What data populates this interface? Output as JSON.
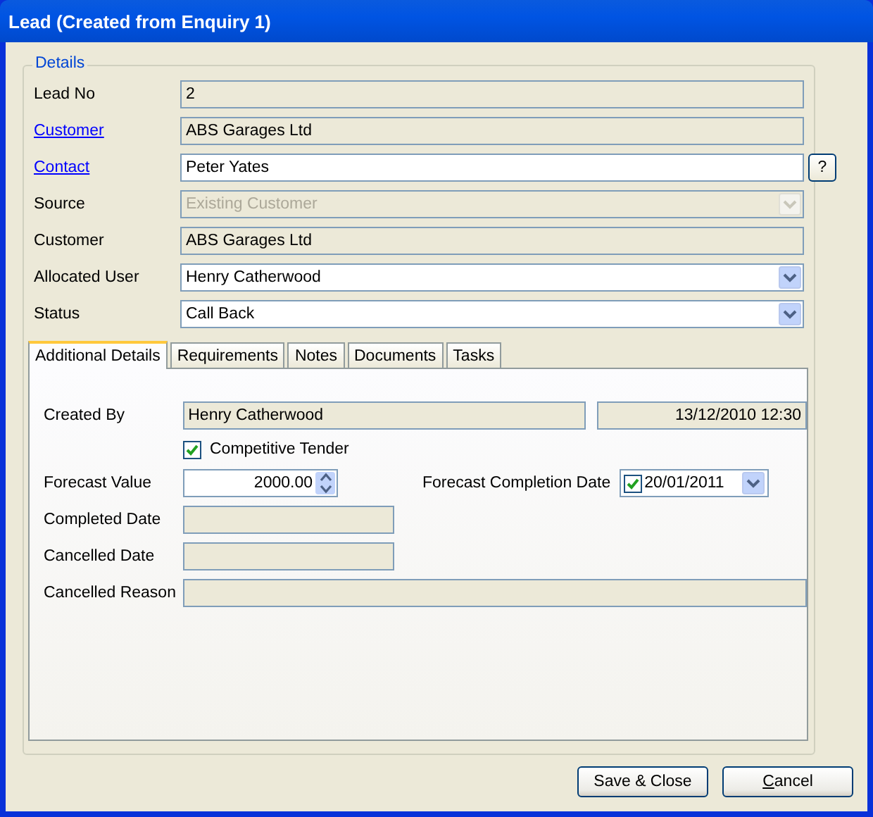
{
  "window": {
    "title": "Lead (Created from Enquiry 1)"
  },
  "details": {
    "legend": "Details",
    "fields": [
      {
        "label": "Lead No",
        "link": false,
        "kind": "readonly",
        "value": "2"
      },
      {
        "label": "Customer",
        "link": true,
        "kind": "readonly",
        "value": "ABS Garages Ltd"
      },
      {
        "label": "Contact",
        "link": true,
        "kind": "text",
        "value": "Peter Yates",
        "help": "?"
      },
      {
        "label": "Source",
        "link": false,
        "kind": "select",
        "value": "Existing Customer",
        "disabled": true
      },
      {
        "label": "Customer",
        "link": false,
        "kind": "readonly",
        "value": "ABS Garages Ltd"
      },
      {
        "label": "Allocated User",
        "link": false,
        "kind": "select",
        "value": "Henry Catherwood",
        "disabled": false
      },
      {
        "label": "Status",
        "link": false,
        "kind": "select",
        "value": "Call Back",
        "disabled": false
      }
    ]
  },
  "tabs": [
    {
      "label": "Additional Details",
      "selected": true
    },
    {
      "label": "Requirements",
      "selected": false
    },
    {
      "label": "Notes",
      "selected": false
    },
    {
      "label": "Documents",
      "selected": false
    },
    {
      "label": "Tasks",
      "selected": false
    }
  ],
  "additional": {
    "created_by": {
      "label": "Created By",
      "value": "Henry Catherwood",
      "timestamp": "13/12/2010 12:30"
    },
    "competitive_tender": {
      "label": "Competitive Tender",
      "checked": true
    },
    "forecast_value": {
      "label": "Forecast Value",
      "value": "2000.00"
    },
    "forecast_completion_date": {
      "label": "Forecast Completion Date",
      "checked": true,
      "value": "20/01/2011"
    },
    "completed_date": {
      "label": "Completed Date"
    },
    "cancelled_date": {
      "label": "Cancelled Date"
    },
    "cancelled_reason": {
      "label": "Cancelled Reason"
    }
  },
  "buttons": [
    {
      "label": "Save & Close",
      "mnemonic": false
    },
    {
      "label": "Cancel",
      "mnemonic": true
    }
  ]
}
